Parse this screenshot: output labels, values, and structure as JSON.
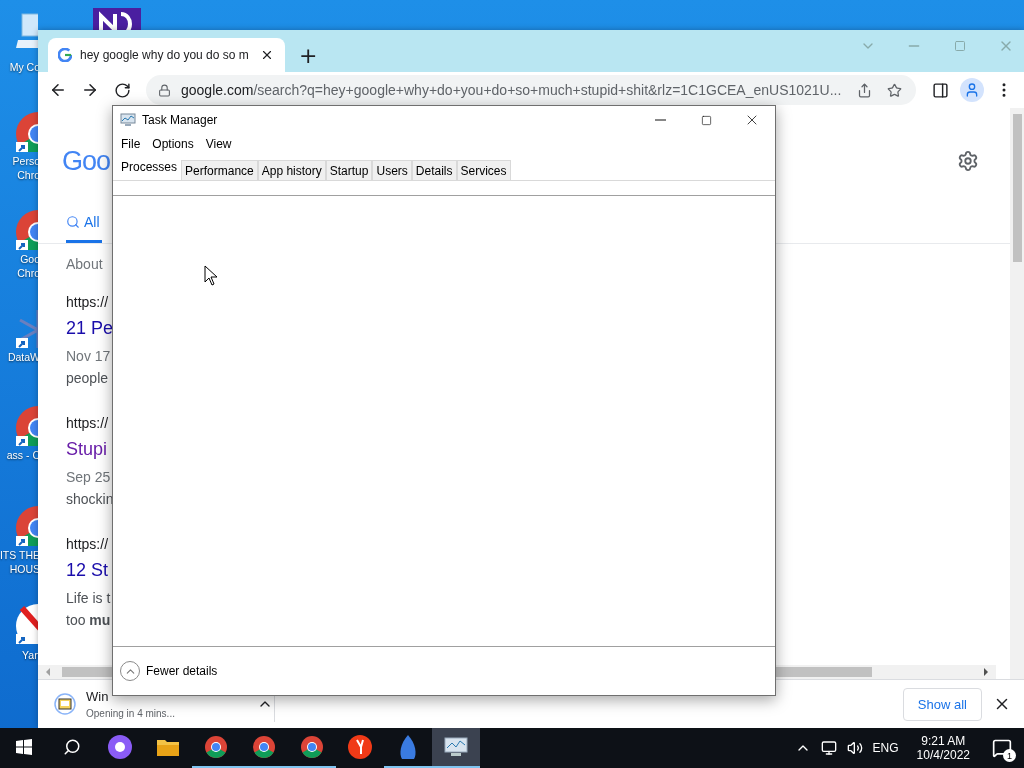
{
  "desktop": {
    "icons": [
      {
        "kind": "computer",
        "lines": [
          "My Co"
        ]
      },
      {
        "kind": "chrome",
        "lines": [
          "Perso",
          "Chro"
        ]
      },
      {
        "kind": "chrome",
        "lines": [
          "Goo",
          "Chro"
        ]
      },
      {
        "kind": "snowflake",
        "lines": [
          "DataW"
        ]
      },
      {
        "kind": "chrome",
        "lines": [
          "ass - C"
        ]
      },
      {
        "kind": "chrome",
        "lines": [
          "ITS THE",
          "HOUS"
        ]
      },
      {
        "kind": "yandex",
        "lines": [
          "Yan"
        ]
      }
    ]
  },
  "browser": {
    "tab_title": "hey google why do you do so m",
    "new_tab": "+",
    "address": {
      "domain": "google.com",
      "path": "/search?q=hey+google+why+do+you+do+so+much+stupid+shit&rlz=1C1GCEA_enUS1021U..."
    },
    "page": {
      "logo": "Goo",
      "search_tab": "All",
      "about": "About",
      "results": [
        {
          "url": "https://",
          "title": "21 Pe",
          "visited": false,
          "lines": [
            "Nov 17",
            "people"
          ]
        },
        {
          "url": "https://",
          "title": "Stupi",
          "visited": true,
          "lines": [
            "Sep 25",
            "shockin"
          ]
        },
        {
          "url": "https://",
          "title": "12 St",
          "visited": false,
          "lines": [
            "Life is t",
            "too **mu**"
          ]
        }
      ]
    },
    "download": {
      "file": "Win",
      "status": "Opening in 4 mins...",
      "show_all": "Show all"
    }
  },
  "task_manager": {
    "title": "Task Manager",
    "menu": [
      "File",
      "Options",
      "View"
    ],
    "tabs": [
      {
        "label": "Processes",
        "selected": true
      },
      {
        "label": "Performance",
        "selected": false
      },
      {
        "label": "App history",
        "selected": false
      },
      {
        "label": "Startup",
        "selected": false
      },
      {
        "label": "Users",
        "selected": false
      },
      {
        "label": "Details",
        "selected": false
      },
      {
        "label": "Services",
        "selected": false
      }
    ],
    "fewer_details": "Fewer details"
  },
  "taskbar": {
    "apps": [
      {
        "kind": "assistant",
        "running": false,
        "active": false
      },
      {
        "kind": "folder",
        "running": false,
        "active": false
      },
      {
        "kind": "chrome",
        "running": true,
        "active": false
      },
      {
        "kind": "chrome",
        "running": true,
        "active": false
      },
      {
        "kind": "chrome",
        "running": true,
        "active": false
      },
      {
        "kind": "yandex",
        "running": false,
        "active": false
      },
      {
        "kind": "feather",
        "running": true,
        "active": false
      },
      {
        "kind": "monitor",
        "running": true,
        "active": true
      }
    ],
    "language": "ENG",
    "time": "9:21 AM",
    "date": "10/4/2022",
    "notifications": "1"
  }
}
